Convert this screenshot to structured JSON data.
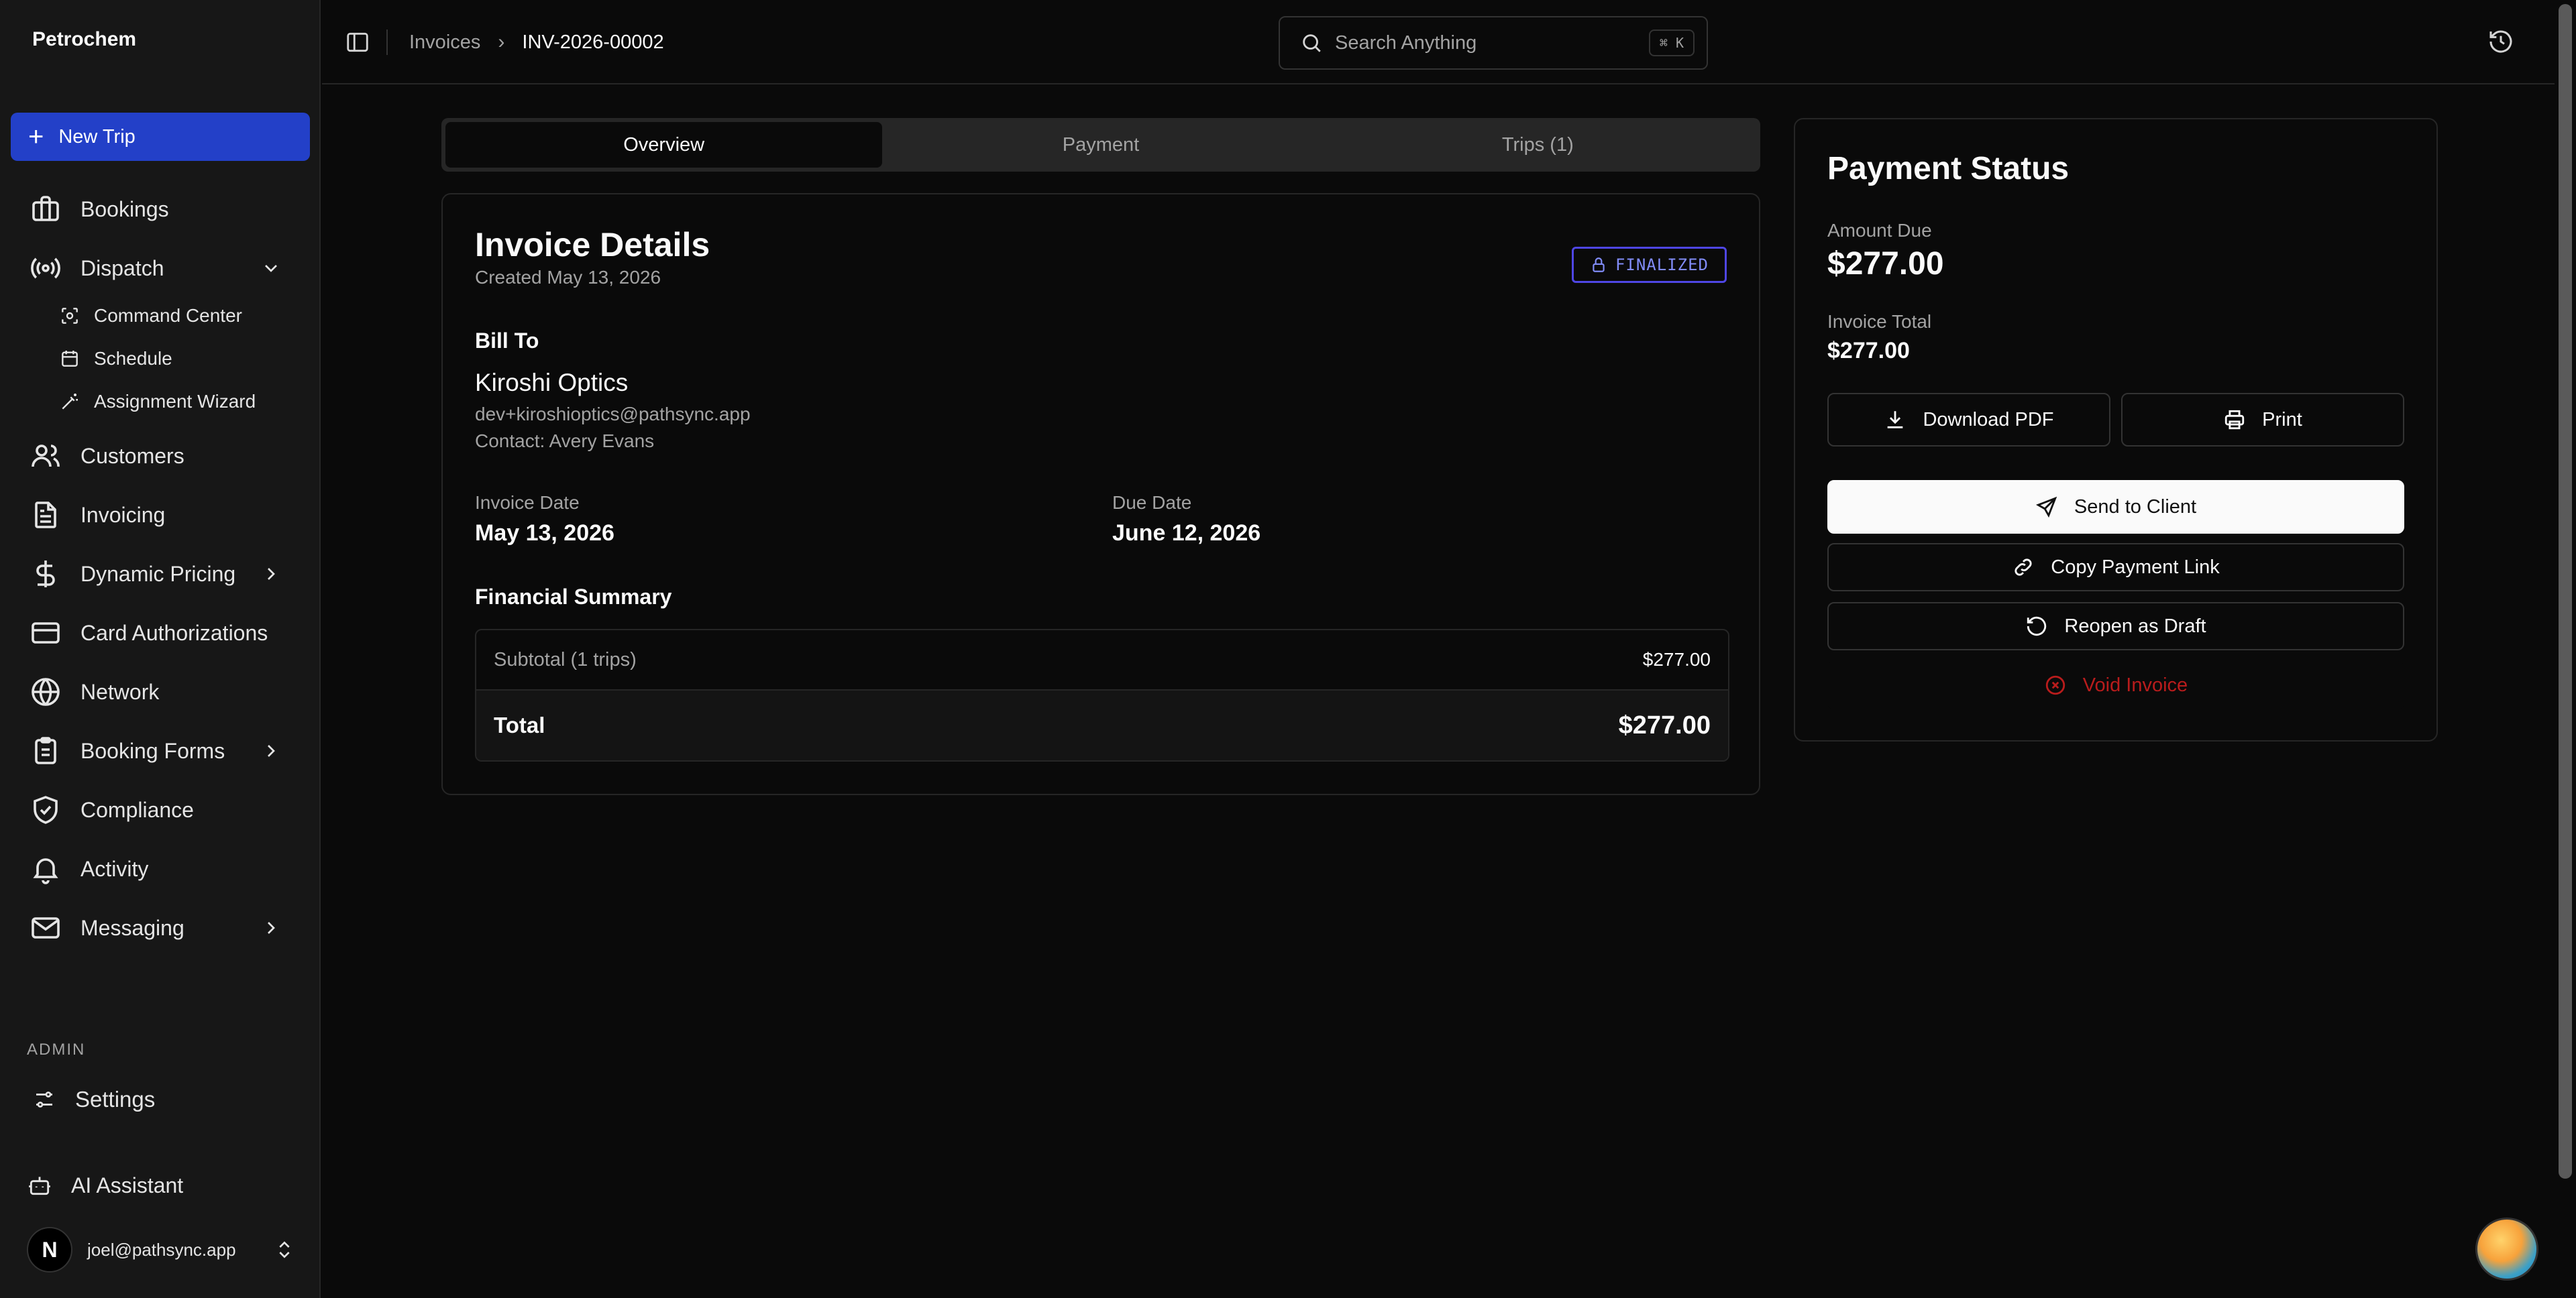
{
  "brand": "Petrochem",
  "sidebar": {
    "new_trip": "New Trip",
    "items": [
      {
        "label": "Bookings"
      },
      {
        "label": "Dispatch"
      },
      {
        "label": "Customers"
      },
      {
        "label": "Invoicing"
      },
      {
        "label": "Dynamic Pricing"
      },
      {
        "label": "Card Authorizations"
      },
      {
        "label": "Network"
      },
      {
        "label": "Booking Forms"
      },
      {
        "label": "Compliance"
      },
      {
        "label": "Activity"
      },
      {
        "label": "Messaging"
      }
    ],
    "dispatch_sub": [
      {
        "label": "Command Center"
      },
      {
        "label": "Schedule"
      },
      {
        "label": "Assignment Wizard"
      }
    ],
    "admin_label": "ADMIN",
    "settings": "Settings",
    "ai_assistant": "AI Assistant",
    "user": {
      "initial": "N",
      "email": "joel@pathsync.app"
    }
  },
  "topbar": {
    "breadcrumb": {
      "parent": "Invoices",
      "separator": "›",
      "current": "INV-2026-00002"
    },
    "search": {
      "placeholder": "Search Anything",
      "shortcut": "⌘ K"
    }
  },
  "tabs": [
    {
      "label": "Overview",
      "active": true
    },
    {
      "label": "Payment",
      "active": false
    },
    {
      "label": "Trips (1)",
      "active": false
    }
  ],
  "invoice": {
    "title": "Invoice Details",
    "created": "Created May 13, 2026",
    "status": "FINALIZED",
    "bill_to_label": "Bill To",
    "customer": {
      "name": "Kiroshi Optics",
      "email": "dev+kiroshioptics@pathsync.app",
      "contact": "Contact: Avery Evans"
    },
    "invoice_date_label": "Invoice Date",
    "invoice_date": "May 13, 2026",
    "due_date_label": "Due Date",
    "due_date": "June 12, 2026",
    "financial_summary_label": "Financial Summary",
    "subtotal_label": "Subtotal (1 trips)",
    "subtotal": "$277.00",
    "total_label": "Total",
    "total": "$277.00"
  },
  "payment": {
    "title": "Payment Status",
    "amount_due_label": "Amount Due",
    "amount_due": "$277.00",
    "invoice_total_label": "Invoice Total",
    "invoice_total": "$277.00",
    "download_pdf": "Download PDF",
    "print": "Print",
    "send_to_client": "Send to Client",
    "copy_payment_link": "Copy Payment Link",
    "reopen_as_draft": "Reopen as Draft",
    "void_invoice": "Void Invoice"
  },
  "colors": {
    "accent": "#2340c8",
    "badge": "#818cf8",
    "danger": "#b91c1c"
  }
}
